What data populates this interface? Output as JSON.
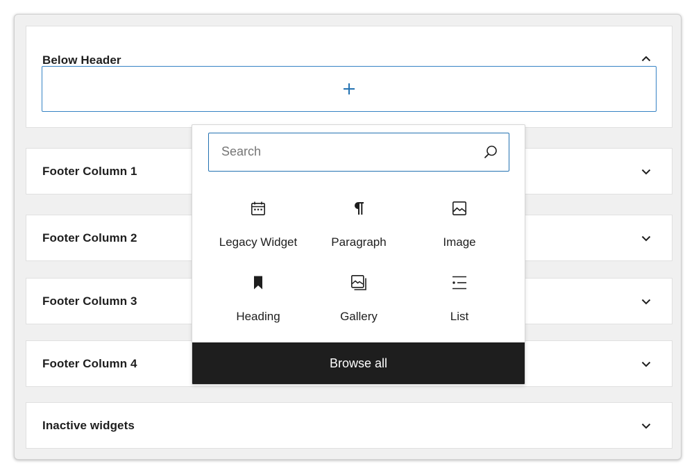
{
  "widget_areas": [
    {
      "title": "Below Header",
      "expanded": true
    },
    {
      "title": "Footer Column 1",
      "expanded": false
    },
    {
      "title": "Footer Column 2",
      "expanded": false
    },
    {
      "title": "Footer Column 3",
      "expanded": false
    },
    {
      "title": "Footer Column 4",
      "expanded": false
    },
    {
      "title": "Inactive widgets",
      "expanded": false
    }
  ],
  "appender": {
    "icon": "plus-icon",
    "color": "#2271b1"
  },
  "inserter": {
    "search": {
      "placeholder": "Search",
      "value": "",
      "icon": "search-icon"
    },
    "blocks": [
      {
        "label": "Legacy Widget",
        "icon": "calendar-icon"
      },
      {
        "label": "Paragraph",
        "icon": "pilcrow-icon"
      },
      {
        "label": "Image",
        "icon": "image-icon"
      },
      {
        "label": "Heading",
        "icon": "bookmark-icon"
      },
      {
        "label": "Gallery",
        "icon": "gallery-icon"
      },
      {
        "label": "List",
        "icon": "list-icon"
      }
    ],
    "browse_all_label": "Browse all"
  },
  "colors": {
    "accent": "#2271b1",
    "dark": "#1e1e1e",
    "frame_bg": "#f0f0f0"
  }
}
